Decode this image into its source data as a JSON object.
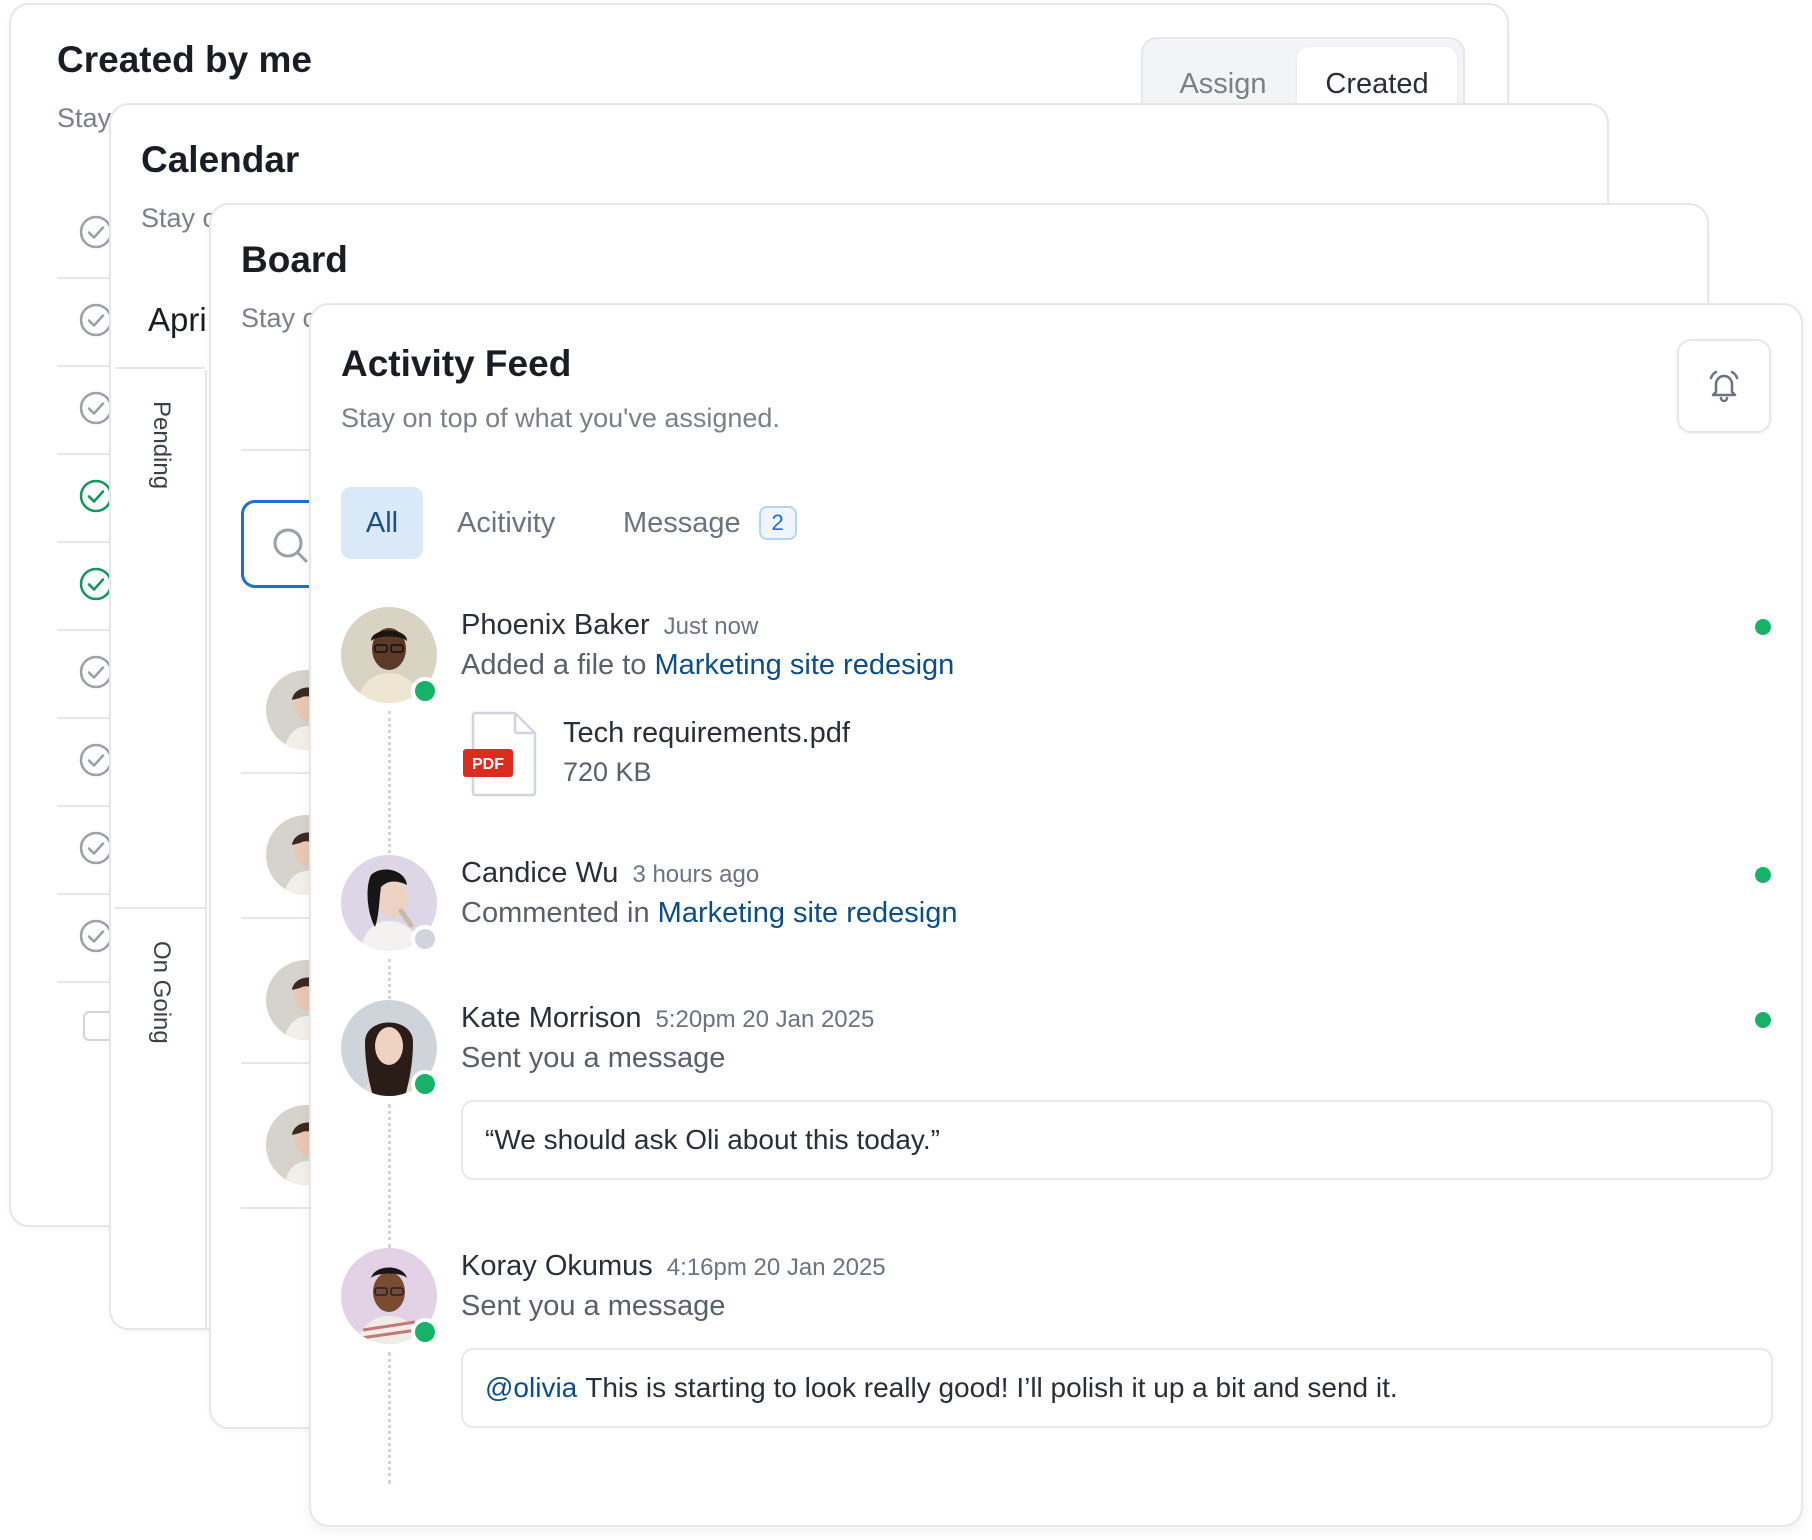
{
  "created_card": {
    "title": "Created by me",
    "subtitle": "Stay",
    "segmented": {
      "assign": "Assign",
      "created": "Created"
    },
    "tasks": [
      {
        "done": false
      },
      {
        "done": false
      },
      {
        "done": false
      },
      {
        "done": true
      },
      {
        "done": true
      },
      {
        "done": false
      },
      {
        "done": false
      },
      {
        "done": false
      },
      {
        "done": false
      }
    ]
  },
  "calendar_card": {
    "title": "Calendar",
    "subtitle": "Stay c",
    "month": "Apri",
    "columns": [
      "Pending",
      "On Going"
    ]
  },
  "board_card": {
    "title": "Board",
    "subtitle": "Stay c"
  },
  "activity_card": {
    "title": "Activity Feed",
    "subtitle": "Stay on top of what you've assigned.",
    "bell_icon": "bell-icon",
    "tabs": {
      "all": "All",
      "activity": "Acitivity",
      "message": "Message",
      "message_count": "2"
    },
    "items": [
      {
        "name": "Phoenix Baker",
        "time": "Just now",
        "action_prefix": "Added a file to",
        "link": "Marketing site redesign",
        "status": "online",
        "unread": true,
        "file": {
          "badge": "PDF",
          "name": "Tech requirements.pdf",
          "size": "720 KB"
        }
      },
      {
        "name": "Candice Wu",
        "time": "3 hours ago",
        "action_prefix": "Commented in",
        "link": "Marketing site redesign",
        "status": "offline",
        "unread": true
      },
      {
        "name": "Kate Morrison",
        "time": "5:20pm 20 Jan 2025",
        "action": "Sent you a message",
        "status": "online",
        "unread": true,
        "message": "“We should ask Oli about this today.”"
      },
      {
        "name": "Koray Okumus",
        "time": "4:16pm 20 Jan 2025",
        "action": "Sent you a message",
        "status": "online",
        "unread": false,
        "mention": "@olivia",
        "message": "This is starting to look really good! I’ll polish it up a bit and send it."
      }
    ]
  },
  "colors": {
    "online": "#17b26a",
    "link": "#0b4d87",
    "tab_active_bg": "#d9e9f7",
    "search_border": "#1d6fd1",
    "pdf_red": "#d92d20"
  }
}
